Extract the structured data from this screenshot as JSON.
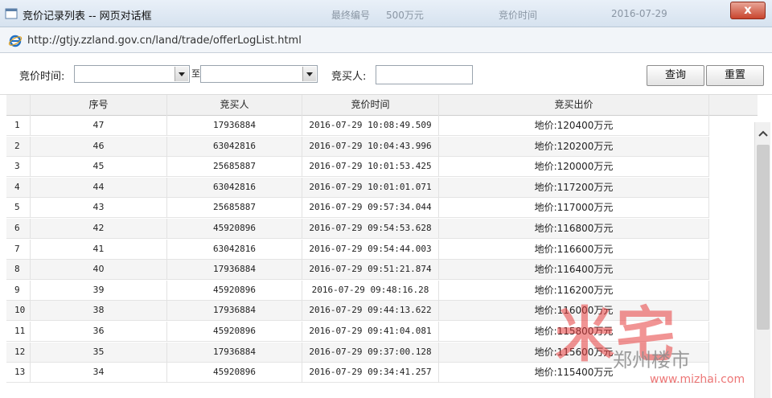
{
  "window": {
    "title": "竞价记录列表 -- 网页对话框",
    "close_label": "x",
    "ghost_texts": [
      "最终编号",
      "500万元",
      "竞价时间",
      "2016-07-29"
    ]
  },
  "address": {
    "url": "http://gtjy.zzland.gov.cn/land/trade/offerLogList.html"
  },
  "filter": {
    "time_label": "竞价时间:",
    "separator": "至",
    "buyer_label": "竞买人:",
    "buyer_value": "",
    "query_label": "查询",
    "reset_label": "重置"
  },
  "table": {
    "columns": [
      "",
      "序号",
      "竞买人",
      "竞价时间",
      "竞买出价",
      ""
    ],
    "rows": [
      {
        "idx": "1",
        "seq": "47",
        "buyer": "17936884",
        "time": "2016-07-29 10:08:49.509",
        "price": "地价:120400万元"
      },
      {
        "idx": "2",
        "seq": "46",
        "buyer": "63042816",
        "time": "2016-07-29 10:04:43.996",
        "price": "地价:120200万元"
      },
      {
        "idx": "3",
        "seq": "45",
        "buyer": "25685887",
        "time": "2016-07-29 10:01:53.425",
        "price": "地价:120000万元"
      },
      {
        "idx": "4",
        "seq": "44",
        "buyer": "63042816",
        "time": "2016-07-29 10:01:01.071",
        "price": "地价:117200万元"
      },
      {
        "idx": "5",
        "seq": "43",
        "buyer": "25685887",
        "time": "2016-07-29 09:57:34.044",
        "price": "地价:117000万元"
      },
      {
        "idx": "6",
        "seq": "42",
        "buyer": "45920896",
        "time": "2016-07-29 09:54:53.628",
        "price": "地价:116800万元"
      },
      {
        "idx": "7",
        "seq": "41",
        "buyer": "63042816",
        "time": "2016-07-29 09:54:44.003",
        "price": "地价:116600万元"
      },
      {
        "idx": "8",
        "seq": "40",
        "buyer": "17936884",
        "time": "2016-07-29 09:51:21.874",
        "price": "地价:116400万元"
      },
      {
        "idx": "9",
        "seq": "39",
        "buyer": "45920896",
        "time": "2016-07-29 09:48:16.28",
        "price": "地价:116200万元"
      },
      {
        "idx": "10",
        "seq": "38",
        "buyer": "17936884",
        "time": "2016-07-29 09:44:13.622",
        "price": "地价:116000万元"
      },
      {
        "idx": "11",
        "seq": "36",
        "buyer": "45920896",
        "time": "2016-07-29 09:41:04.081",
        "price": "地价:115800万元"
      },
      {
        "idx": "12",
        "seq": "35",
        "buyer": "17936884",
        "time": "2016-07-29 09:37:00.128",
        "price": "地价:115600万元"
      },
      {
        "idx": "13",
        "seq": "34",
        "buyer": "45920896",
        "time": "2016-07-29 09:34:41.257",
        "price": "地价:115400万元"
      }
    ]
  },
  "watermark": {
    "brand": "米宅",
    "wechat": "郑州楼市",
    "site": "www.mizhai.com"
  },
  "icons": {
    "app": "dialog-icon",
    "browser": "ie-icon",
    "dropdown": "chevron-down-icon",
    "scroll_up": "chevron-up-icon"
  }
}
